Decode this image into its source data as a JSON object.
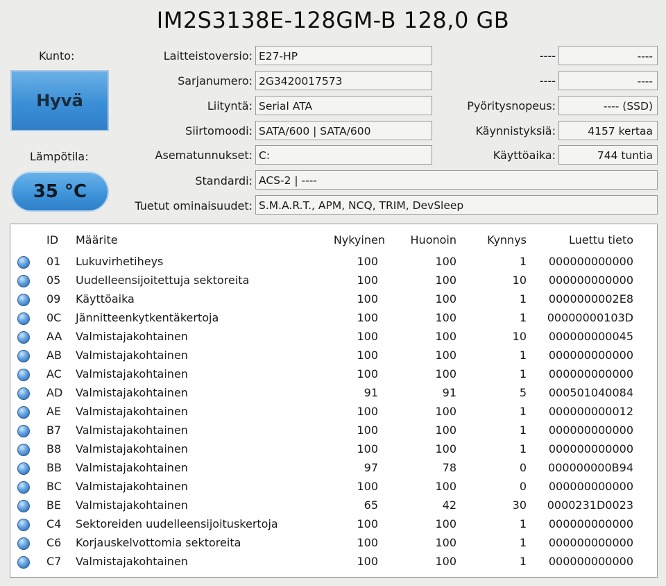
{
  "title": "IM2S3138E-128GM-B 128,0 GB",
  "health": {
    "label": "Kunto:",
    "value": "Hyvä"
  },
  "temperature": {
    "label": "Lämpötila:",
    "value": "35 °C"
  },
  "fields_left": [
    {
      "label": "Laitteistoversio:",
      "value": "E27-HP"
    },
    {
      "label": "Sarjanumero:",
      "value": "2G3420017573"
    },
    {
      "label": "Liityntä:",
      "value": "Serial ATA"
    },
    {
      "label": "Siirtomoodi:",
      "value": "SATA/600 | SATA/600"
    },
    {
      "label": "Asematunnukset:",
      "value": "C:"
    },
    {
      "label": "Standardi:",
      "value": "ACS-2 | ----"
    },
    {
      "label": "Tuetut ominaisuudet:",
      "value": "S.M.A.R.T., APM, NCQ, TRIM, DevSleep"
    }
  ],
  "fields_right": [
    {
      "label": "----",
      "value": "----"
    },
    {
      "label": "----",
      "value": "----"
    },
    {
      "label": "Pyöritysnopeus:",
      "value": "---- (SSD)"
    },
    {
      "label": "Käynnistyksiä:",
      "value": "4157 kertaa"
    },
    {
      "label": "Käyttöaika:",
      "value": "744 tuntia"
    }
  ],
  "smart_table": {
    "headers": [
      "ID",
      "Määrite",
      "Nykyinen",
      "Huonoin",
      "Kynnys",
      "Luettu tieto"
    ],
    "rows": [
      [
        "01",
        "Lukuvirhetiheys",
        "100",
        "100",
        "1",
        "000000000000"
      ],
      [
        "05",
        "Uudelleensijoitettuja sektoreita",
        "100",
        "100",
        "10",
        "000000000000"
      ],
      [
        "09",
        "Käyttöaika",
        "100",
        "100",
        "1",
        "0000000002E8"
      ],
      [
        "0C",
        "Jännitteenkytkentäkertoja",
        "100",
        "100",
        "1",
        "00000000103D"
      ],
      [
        "AA",
        "Valmistajakohtainen",
        "100",
        "100",
        "10",
        "000000000045"
      ],
      [
        "AB",
        "Valmistajakohtainen",
        "100",
        "100",
        "1",
        "000000000000"
      ],
      [
        "AC",
        "Valmistajakohtainen",
        "100",
        "100",
        "1",
        "000000000000"
      ],
      [
        "AD",
        "Valmistajakohtainen",
        "91",
        "91",
        "5",
        "000501040084"
      ],
      [
        "AE",
        "Valmistajakohtainen",
        "100",
        "100",
        "1",
        "000000000012"
      ],
      [
        "B7",
        "Valmistajakohtainen",
        "100",
        "100",
        "1",
        "000000000000"
      ],
      [
        "B8",
        "Valmistajakohtainen",
        "100",
        "100",
        "1",
        "000000000000"
      ],
      [
        "BB",
        "Valmistajakohtainen",
        "97",
        "78",
        "0",
        "000000000B94"
      ],
      [
        "BC",
        "Valmistajakohtainen",
        "100",
        "100",
        "0",
        "000000000000"
      ],
      [
        "BE",
        "Valmistajakohtainen",
        "65",
        "42",
        "30",
        "0000231D0023"
      ],
      [
        "C4",
        "Sektoreiden uudelleensijoituskertoja",
        "100",
        "100",
        "1",
        "000000000000"
      ],
      [
        "C6",
        "Korjauskelvottomia sektoreita",
        "100",
        "100",
        "1",
        "000000000000"
      ],
      [
        "C7",
        "Valmistajakohtainen",
        "100",
        "100",
        "1",
        "000000000000"
      ]
    ]
  },
  "colors": {
    "status_good": "#3b8fd6"
  },
  "icons": {
    "status": "status-dot-icon"
  }
}
